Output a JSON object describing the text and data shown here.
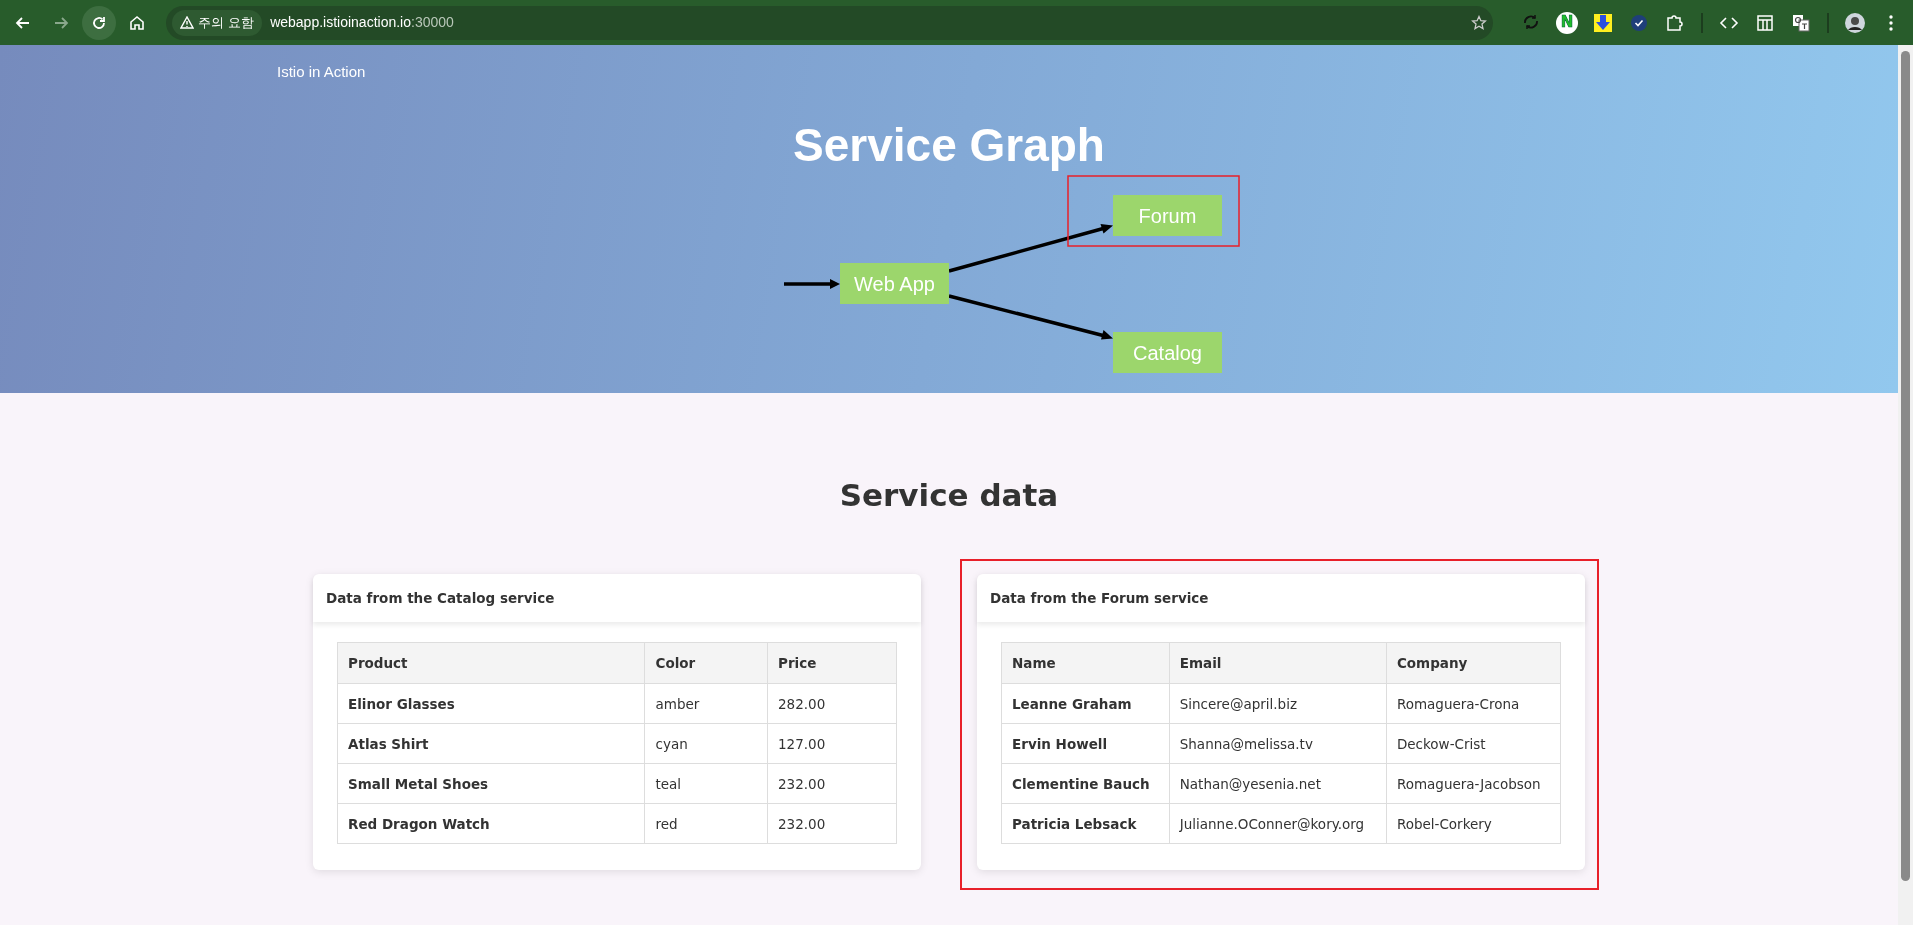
{
  "browser": {
    "nav_buttons": [
      {
        "kind": "back",
        "disabled": false,
        "hovered": false
      },
      {
        "kind": "forward",
        "disabled": true,
        "hovered": false
      },
      {
        "kind": "reload",
        "disabled": false,
        "hovered": true
      },
      {
        "kind": "home",
        "disabled": false,
        "hovered": false
      }
    ],
    "security_chip": "주의 요함",
    "url_host": "webapp.istioinaction.io",
    "url_port": ":30000",
    "toolbar_icons": [
      {
        "kind": "sync"
      },
      {
        "kind": "letter",
        "text": "N"
      },
      {
        "kind": "download"
      },
      {
        "kind": "check"
      },
      {
        "kind": "puzzle"
      },
      {
        "kind": "separator"
      },
      {
        "kind": "code"
      },
      {
        "kind": "layout"
      },
      {
        "kind": "translate"
      },
      {
        "kind": "separator"
      },
      {
        "kind": "avatar"
      },
      {
        "kind": "kebab"
      }
    ]
  },
  "header": {
    "brand": "Istio in Action",
    "title": "Service Graph",
    "graph": {
      "nodes": [
        {
          "label": "Web App",
          "highlighted": false
        },
        {
          "label": "Forum",
          "highlighted": true
        },
        {
          "label": "Catalog",
          "highlighted": false
        }
      ]
    }
  },
  "section_title": "Service data",
  "cards": [
    {
      "title": "Data from the Catalog service",
      "highlighted": false,
      "columns": [
        "Product",
        "Color",
        "Price"
      ],
      "rows": [
        [
          "Elinor Glasses",
          "amber",
          "282.00"
        ],
        [
          "Atlas Shirt",
          "cyan",
          "127.00"
        ],
        [
          "Small Metal Shoes",
          "teal",
          "232.00"
        ],
        [
          "Red Dragon Watch",
          "red",
          "232.00"
        ]
      ]
    },
    {
      "title": "Data from the Forum service",
      "highlighted": true,
      "columns": [
        "Name",
        "Email",
        "Company"
      ],
      "rows": [
        [
          "Leanne Graham",
          "Sincere@april.biz",
          "Romaguera-Crona"
        ],
        [
          "Ervin Howell",
          "Shanna@melissa.tv",
          "Deckow-Crist"
        ],
        [
          "Clementine Bauch",
          "Nathan@yesenia.net",
          "Romaguera-Jacobson"
        ],
        [
          "Patricia Lebsack",
          "Julianne.OConner@kory.org",
          "Robel-Corkery"
        ]
      ]
    }
  ]
}
